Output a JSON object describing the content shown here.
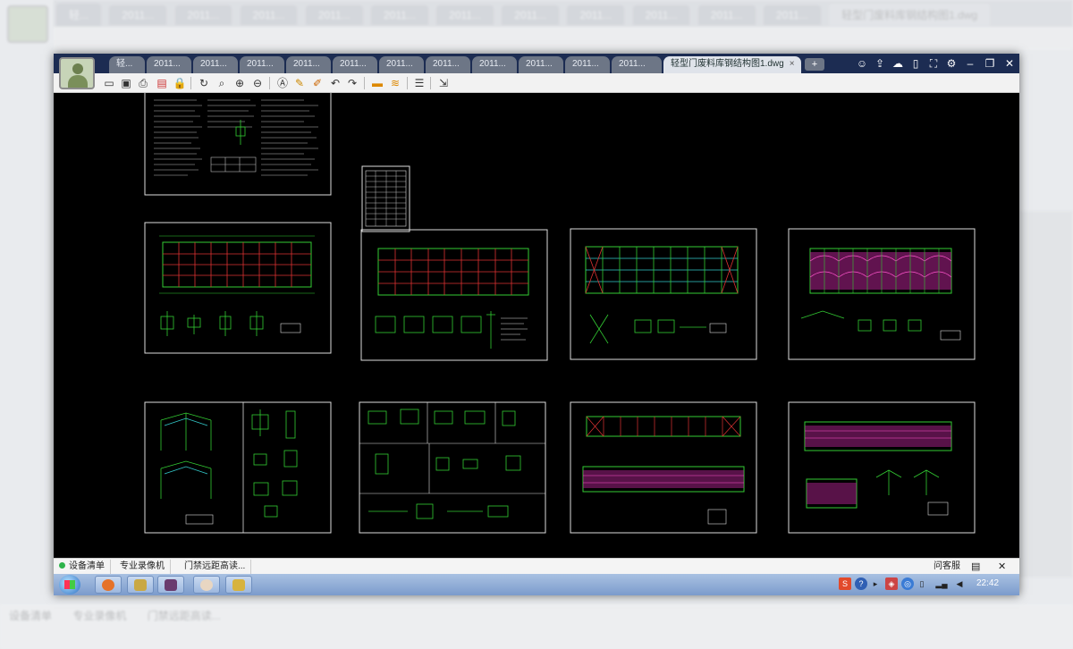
{
  "window": {
    "tabs": [
      "轻...",
      "2011...",
      "2011...",
      "2011...",
      "2011...",
      "2011...",
      "2011...",
      "2011...",
      "2011...",
      "2011...",
      "2011...",
      "2011..."
    ],
    "active_tab": "轻型门废料库钢结构图1.dwg",
    "add_tab_label": "+"
  },
  "toolbar": {
    "icons": [
      "open-icon",
      "save-icon",
      "print-icon",
      "pdf-export-icon",
      "lock-icon",
      "rotate-icon",
      "zoom-window-icon",
      "zoom-in-icon",
      "zoom-out-icon",
      "text-icon",
      "pencil-icon",
      "marker-icon",
      "undo-icon",
      "redo-icon",
      "measure-icon",
      "layer-icon",
      "layers-stack-icon",
      "export-icon"
    ]
  },
  "drawing": {
    "sheets": [
      "general-notes",
      "material-table",
      "column-layout-plan",
      "anchor-bolt-plan",
      "roof-support-plan",
      "roof-purlin-plan",
      "gable-frame-details",
      "node-details",
      "wall-bracing-elevation",
      "wall-purlin-elevation"
    ]
  },
  "statusbar": {
    "tabs": [
      "设备清单",
      "专业录像机",
      "门禁远距高读..."
    ],
    "help_label": "问客服",
    "chat_icon": "chat-icon",
    "close_label": "✕"
  },
  "taskbar": {
    "clock": "22:42"
  },
  "ghost": {
    "tabs": [
      "轻...",
      "2011...",
      "2011...",
      "2011...",
      "2011...",
      "2011...",
      "2011...",
      "2011...",
      "2011...",
      "2011...",
      "2011...",
      "2011..."
    ],
    "active_tab": "轻型门废料库钢结构图1.dwg",
    "status_tabs": [
      "设备清单",
      "专业录像机",
      "门禁远距高读..."
    ]
  }
}
